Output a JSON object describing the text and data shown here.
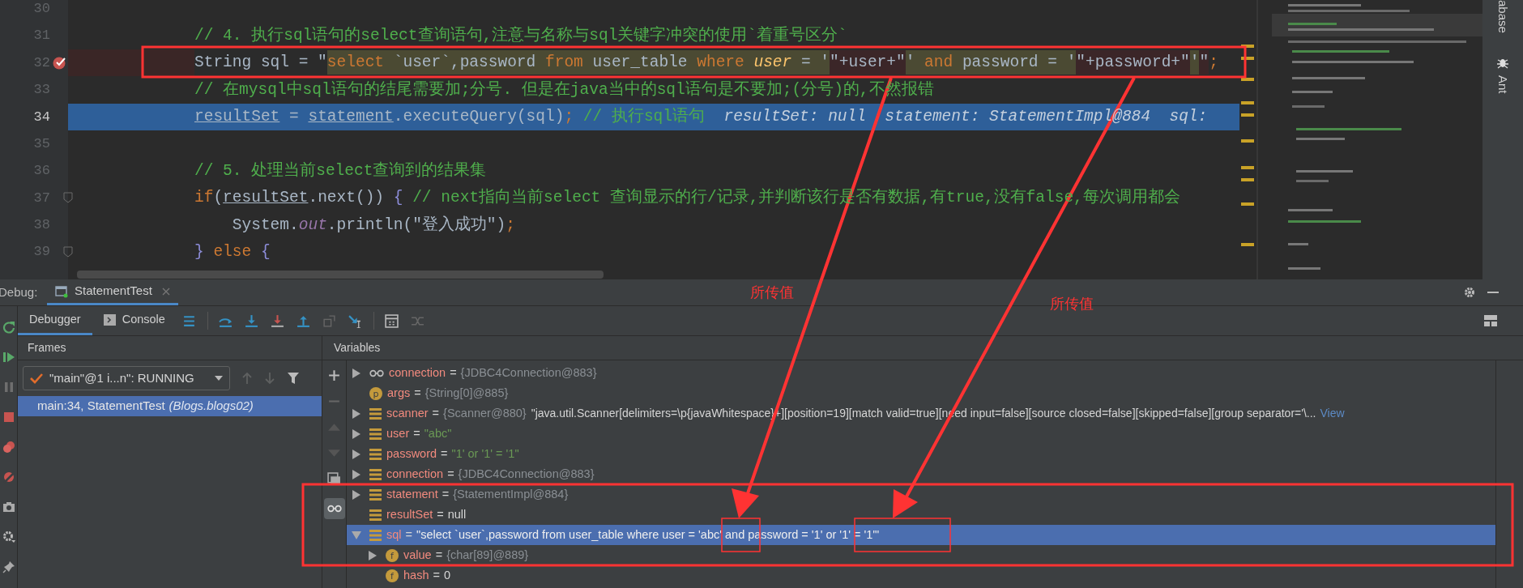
{
  "editor": {
    "lines": [
      {
        "number": "30",
        "current": false,
        "breakpoint": false,
        "fold": false
      },
      {
        "number": "31",
        "current": false,
        "breakpoint": false,
        "fold": false,
        "segments": [
          {
            "text": "// 4. 执行sql语句的select查询语句,注意与名称与sql关键字冲突的使用`着重号区分`",
            "kind": "comment"
          }
        ]
      },
      {
        "number": "32",
        "current": false,
        "breakpoint": true,
        "fold": false,
        "segments": [
          {
            "text": "String sql = \"",
            "kind": "plain"
          },
          {
            "text": "select",
            "kind": "sqlkw"
          },
          {
            "text": " `user`,password ",
            "kind": "sql"
          },
          {
            "text": "from",
            "kind": "sqlkw"
          },
          {
            "text": " user_table ",
            "kind": "sql"
          },
          {
            "text": "where",
            "kind": "sqlkw"
          },
          {
            "text": " user",
            "kind": "sqlid"
          },
          {
            "text": " = '",
            "kind": "sql"
          },
          {
            "text": "\"+user+\"",
            "kind": "concat"
          },
          {
            "text": "' ",
            "kind": "sql"
          },
          {
            "text": "and",
            "kind": "sqlkw"
          },
          {
            "text": " password = '",
            "kind": "sql"
          },
          {
            "text": "\"+password+\"",
            "kind": "concat"
          },
          {
            "text": "'",
            "kind": "sql"
          },
          {
            "text": "\"",
            "kind": "concat"
          },
          {
            "text": ";",
            "kind": "kw"
          }
        ]
      },
      {
        "number": "33",
        "current": false,
        "breakpoint": false,
        "fold": false,
        "segments": [
          {
            "text": "// 在mysql中sql语句的结尾需要加;分号. 但是在java当中的sql语句是不要加;(分号)的,不然报错",
            "kind": "comment"
          }
        ]
      },
      {
        "number": "34",
        "current": true,
        "breakpoint": false,
        "fold": false,
        "segments": [
          {
            "text": "resultSet",
            "kind": "field"
          },
          {
            "text": " = ",
            "kind": "plain"
          },
          {
            "text": "statement",
            "kind": "field"
          },
          {
            "text": ".executeQuery(sql)",
            "kind": "plain"
          },
          {
            "text": ";",
            "kind": "kw"
          },
          {
            "text": " // 执行sql语句",
            "kind": "comment"
          },
          {
            "text": "  resultSet: null  statement: StatementImpl@884  sql:",
            "kind": "hint"
          }
        ]
      },
      {
        "number": "35",
        "current": false,
        "breakpoint": false,
        "fold": false
      },
      {
        "number": "36",
        "current": false,
        "breakpoint": false,
        "fold": false,
        "segments": [
          {
            "text": "// 5. 处理当前select查询到的结果集",
            "kind": "comment"
          }
        ]
      },
      {
        "number": "37",
        "current": false,
        "breakpoint": false,
        "fold": true,
        "segments": [
          {
            "text": "if",
            "kind": "kw"
          },
          {
            "text": "(",
            "kind": "plain"
          },
          {
            "text": "resultSet",
            "kind": "field"
          },
          {
            "text": ".next()) ",
            "kind": "plain"
          },
          {
            "text": "{",
            "kind": "brace"
          },
          {
            "text": " // next指向当前select 查询显示的行/记录,并判断该行是否有数据,有true,没有false,每次调用都会",
            "kind": "comment"
          }
        ]
      },
      {
        "number": "38",
        "current": false,
        "breakpoint": false,
        "fold": false,
        "segments": [
          {
            "text": "    System.",
            "kind": "plain"
          },
          {
            "text": "out",
            "kind": "static"
          },
          {
            "text": ".println(\"登入成功\")",
            "kind": "plain"
          },
          {
            "text": ";",
            "kind": "kw"
          }
        ]
      },
      {
        "number": "39",
        "current": false,
        "breakpoint": false,
        "fold": true,
        "segments": [
          {
            "text": "}",
            "kind": "brace"
          },
          {
            "text": " else ",
            "kind": "kw"
          },
          {
            "text": "{",
            "kind": "brace"
          }
        ]
      }
    ]
  },
  "side_strip": {
    "labels": [
      "abase",
      "Ant"
    ]
  },
  "debug": {
    "label": "Debug:",
    "tabs": [
      {
        "title": "StatementTest",
        "selected": true
      }
    ],
    "inner_tabs": [
      {
        "label": "Debugger",
        "selected": true
      },
      {
        "label": "Console",
        "selected": false
      }
    ],
    "frames": {
      "title": "Frames",
      "thread": "\"main\"@1 i...n\": RUNNING",
      "items": [
        {
          "text": "main:34, StatementTest",
          "package": "(Blogs.blogs02)",
          "selected": true
        }
      ]
    },
    "variables": {
      "title": "Variables",
      "items": [
        {
          "kind": "watch",
          "name": "connection",
          "operator": "=",
          "value": {
            "text": "{JDBC4Connection@883}",
            "kind": "ref"
          },
          "expandable": true,
          "expanded": false,
          "selected": false
        },
        {
          "kind": "param",
          "badge": "p",
          "name": "args",
          "operator": "=",
          "value": {
            "text": "{String[0]@885}",
            "kind": "ref"
          },
          "expandable": false,
          "selected": false
        },
        {
          "kind": "local",
          "name": "scanner",
          "operator": "=",
          "value": {
            "text": "{Scanner@880}",
            "kind": "ref"
          },
          "detail": "\"java.util.Scanner[delimiters=\\p{javaWhitespace}+][position=19][match valid=true][need input=false][source closed=false][skipped=false][group separator='\\...",
          "link": "View",
          "expandable": true,
          "expanded": false,
          "selected": false
        },
        {
          "kind": "local",
          "name": "user",
          "operator": "=",
          "value": {
            "text": "\"abc\"",
            "kind": "string"
          },
          "expandable": true,
          "expanded": false,
          "selected": false
        },
        {
          "kind": "local",
          "name": "password",
          "operator": "=",
          "value": {
            "text": "\"1' or '1' = '1\"",
            "kind": "string"
          },
          "expandable": true,
          "expanded": false,
          "selected": false
        },
        {
          "kind": "local",
          "name": "connection",
          "operator": "=",
          "value": {
            "text": "{JDBC4Connection@883}",
            "kind": "ref"
          },
          "expandable": true,
          "expanded": false,
          "selected": false
        },
        {
          "kind": "local",
          "name": "statement",
          "operator": "=",
          "value": {
            "text": "{StatementImpl@884}",
            "kind": "ref"
          },
          "expandable": true,
          "expanded": false,
          "selected": false
        },
        {
          "kind": "local",
          "name": "resultSet",
          "operator": "=",
          "value": {
            "text": "null",
            "kind": "plain"
          },
          "expandable": false,
          "selected": false
        },
        {
          "kind": "local",
          "name": "sql",
          "operator": "=",
          "value": {
            "text": "\"select `user`,password from user_table where user = 'abc' and password = '1' or '1' = '1'\"",
            "kind": "plain"
          },
          "expandable": true,
          "expanded": true,
          "selected": true,
          "children": [
            {
              "kind": "field",
              "badge": "f",
              "name": "value",
              "operator": "=",
              "value": {
                "text": "{char[89]@889}",
                "kind": "ref"
              },
              "expandable": true,
              "expanded": false,
              "selected": false
            },
            {
              "kind": "field",
              "badge": "f",
              "name": "hash",
              "operator": "=",
              "value": {
                "text": "0",
                "kind": "plain"
              },
              "expandable": false,
              "selected": false
            }
          ]
        }
      ]
    }
  },
  "annotations": {
    "labels": [
      "所传值",
      "所传值"
    ]
  }
}
